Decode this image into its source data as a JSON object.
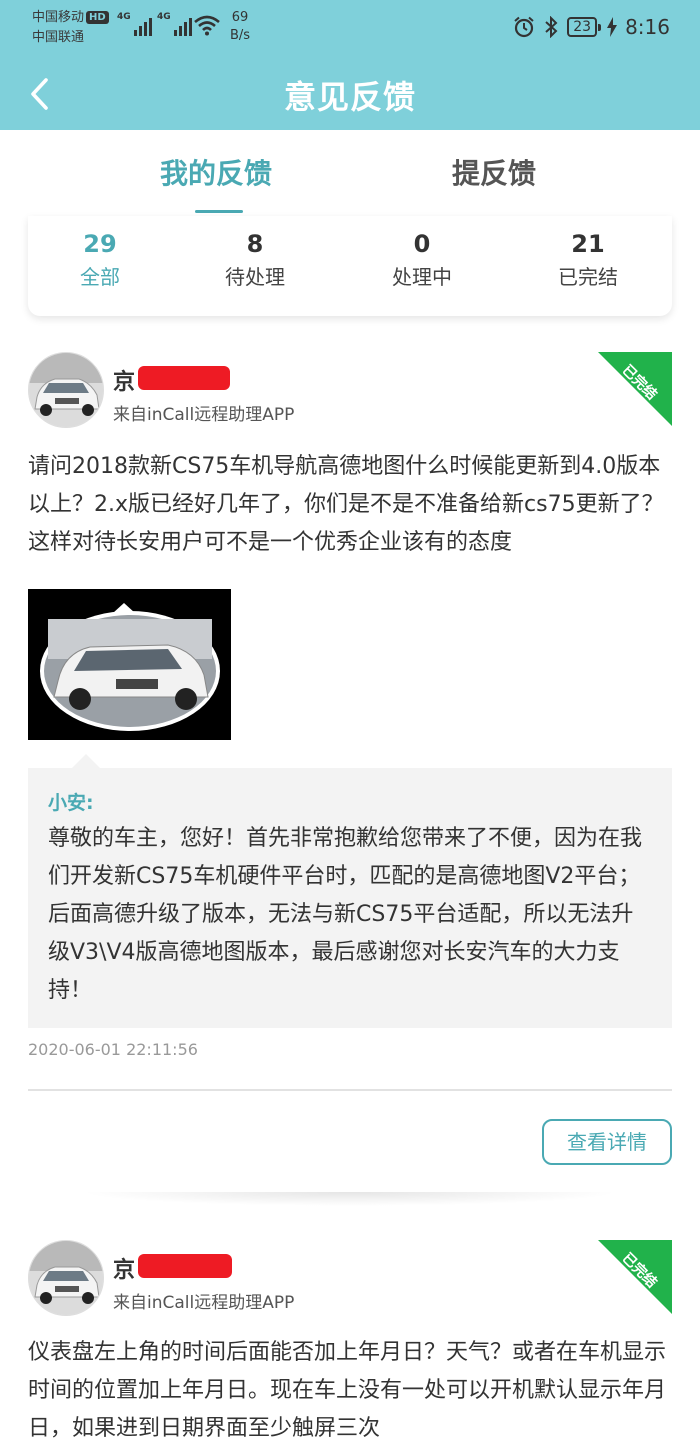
{
  "status_bar": {
    "carrier_1": "中国移动",
    "carrier_1_badge": "HD",
    "carrier_2": "中国联通",
    "network_1": "4G",
    "network_2": "4G",
    "speed_value": "69",
    "speed_unit": "B/s",
    "battery": "23",
    "time": "8:16",
    "icons": [
      "alarm-icon",
      "bluetooth-icon",
      "battery-icon",
      "charging-icon",
      "wifi-icon",
      "signal-icon"
    ]
  },
  "header": {
    "title": "意见反馈",
    "back_icon": "chevron-left-icon"
  },
  "tabs": [
    {
      "label": "我的反馈",
      "active": true
    },
    {
      "label": "提反馈",
      "active": false
    }
  ],
  "stats": [
    {
      "count": "29",
      "label": "全部",
      "active": true
    },
    {
      "count": "8",
      "label": "待处理",
      "active": false
    },
    {
      "count": "0",
      "label": "处理中",
      "active": false
    },
    {
      "count": "21",
      "label": "已完结",
      "active": false
    }
  ],
  "colors": {
    "header_bg": "#7fd0da",
    "accent": "#4aa9b3",
    "status_done": "#21b24b",
    "redaction": "#ee1b24"
  },
  "feedback": [
    {
      "user": "京",
      "source": "来自inCall远程助理APP",
      "status": "已完结",
      "content": "请问2018款新CS75车机导航高德地图什么时候能更新到4.0版本以上？2.x版已经好几年了，你们是不是不准备给新cs75更新了？这样对待长安用户可不是一个优秀企业该有的态度",
      "reply_name": "小安:",
      "reply_text": "尊敬的车主，您好！首先非常抱歉给您带来了不便，因为在我们开发新CS75车机硬件平台时，匹配的是高德地图V2平台；后面高德升级了版本，无法与新CS75平台适配，所以无法升级V3\\V4版高德地图版本，最后感谢您对长安汽车的大力支持！",
      "date": "2020-06-01 22:11:56",
      "detail_label": "查看详情"
    },
    {
      "user": "京",
      "source": "来自inCall远程助理APP",
      "status": "已完结",
      "content": "仪表盘左上角的时间后面能否加上年月日？天气？或者在车机显示时间的位置加上年月日。现在车上没有一处可以开机默认显示年月日，如果进到日期界面至少触屏三次"
    }
  ]
}
